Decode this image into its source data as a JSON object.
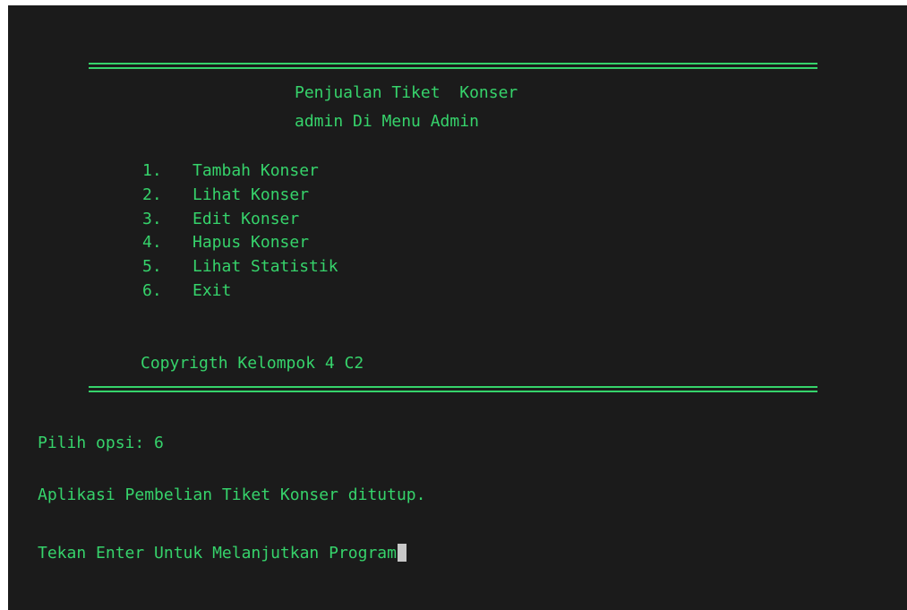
{
  "header": {
    "title": "Penjualan Tiket  Konser",
    "subtitle": "admin Di Menu Admin"
  },
  "menu": {
    "items": [
      {
        "num": "1.",
        "label": "Tambah Konser"
      },
      {
        "num": "2.",
        "label": "Lihat Konser"
      },
      {
        "num": "3.",
        "label": "Edit Konser"
      },
      {
        "num": "4.",
        "label": "Hapus Konser"
      },
      {
        "num": "5.",
        "label": "Lihat Statistik"
      },
      {
        "num": "6.",
        "label": "Exit"
      }
    ]
  },
  "footer": {
    "copyright": "Copyrigth Kelompok 4 C2"
  },
  "console": {
    "prompt": "Pilih opsi: 6",
    "message": "Aplikasi Pembelian Tiket Konser ditutup.",
    "continue": "Tekan Enter Untuk Melanjutkan Program"
  },
  "colors": {
    "background": "#1b1b1b",
    "text": "#36d36b",
    "cursor": "#c8c8c8"
  }
}
